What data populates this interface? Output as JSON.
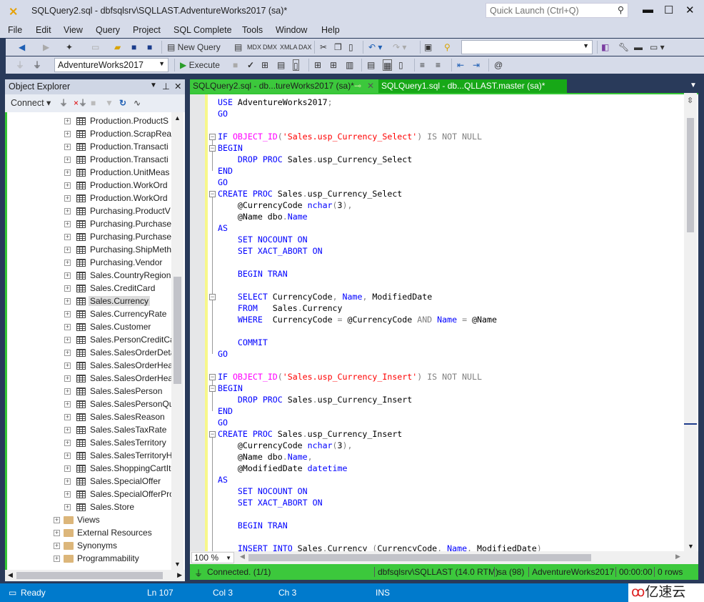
{
  "window": {
    "title": "SQLQuery2.sql - dbfsqlsrv\\SQLLAST.AdventureWorks2017 (sa)*",
    "quick_launch_placeholder": "Quick Launch (Ctrl+Q)"
  },
  "menu": [
    "File",
    "Edit",
    "View",
    "Query",
    "Project",
    "SQL Complete",
    "Tools",
    "Window",
    "Help"
  ],
  "toolbar": {
    "new_query": "New Query",
    "execute": "Execute",
    "database": "AdventureWorks2017",
    "solution_combo": ""
  },
  "object_explorer": {
    "title": "Object Explorer",
    "connect": "Connect",
    "tables": [
      "Production.ProductS",
      "Production.ScrapRea",
      "Production.Transacti",
      "Production.Transacti",
      "Production.UnitMeas",
      "Production.WorkOrd",
      "Production.WorkOrd",
      "Purchasing.ProductV",
      "Purchasing.Purchase",
      "Purchasing.Purchase",
      "Purchasing.ShipMeth",
      "Purchasing.Vendor",
      "Sales.CountryRegion",
      "Sales.CreditCard",
      "Sales.Currency",
      "Sales.CurrencyRate",
      "Sales.Customer",
      "Sales.PersonCreditCa",
      "Sales.SalesOrderDetai",
      "Sales.SalesOrderHeac",
      "Sales.SalesOrderHeac",
      "Sales.SalesPerson",
      "Sales.SalesPersonQuo",
      "Sales.SalesReason",
      "Sales.SalesTaxRate",
      "Sales.SalesTerritory",
      "Sales.SalesTerritoryHi",
      "Sales.ShoppingCartIte",
      "Sales.SpecialOffer",
      "Sales.SpecialOfferPro",
      "Sales.Store"
    ],
    "selected": "Sales.Currency",
    "folders": [
      "Views",
      "External Resources",
      "Synonyms",
      "Programmability"
    ]
  },
  "tabs": [
    {
      "label": "SQLQuery2.sql - db...tureWorks2017 (sa)*",
      "active": true
    },
    {
      "label": "SQLQuery1.sql - db...QLLAST.master (sa)*",
      "active": false
    }
  ],
  "colors": {
    "keyword": "#0000ff",
    "function": "#ff00ff",
    "string": "#ff0000",
    "operator": "#808080",
    "status_green": "#3cc83c",
    "statusbar_blue": "#007acc"
  },
  "code": [
    [
      [
        "k",
        "USE"
      ],
      [
        "t",
        " AdventureWorks2017"
      ],
      [
        "g",
        ";"
      ]
    ],
    [
      [
        "k",
        "GO"
      ]
    ],
    [],
    [
      [
        "k",
        "IF "
      ],
      [
        "f",
        "OBJECT_ID"
      ],
      [
        "g",
        "("
      ],
      [
        "s",
        "'Sales.usp_Currency_Select'"
      ],
      [
        "g",
        ") IS NOT NULL"
      ]
    ],
    [
      [
        "k",
        "BEGIN"
      ]
    ],
    [
      [
        "t",
        "    "
      ],
      [
        "k",
        "DROP PROC"
      ],
      [
        "t",
        " Sales"
      ],
      [
        "g",
        "."
      ],
      [
        "t",
        "usp_Currency_Select"
      ]
    ],
    [
      [
        "k",
        "END"
      ]
    ],
    [
      [
        "k",
        "GO"
      ]
    ],
    [
      [
        "k",
        "CREATE PROC"
      ],
      [
        "t",
        " Sales"
      ],
      [
        "g",
        "."
      ],
      [
        "t",
        "usp_Currency_Select"
      ]
    ],
    [
      [
        "t",
        "    @CurrencyCode "
      ],
      [
        "k",
        "nchar"
      ],
      [
        "g",
        "("
      ],
      [
        "t",
        "3"
      ],
      [
        "g",
        "),"
      ]
    ],
    [
      [
        "t",
        "    @Name dbo"
      ],
      [
        "g",
        "."
      ],
      [
        "k",
        "Name"
      ]
    ],
    [
      [
        "k",
        "AS"
      ]
    ],
    [
      [
        "t",
        "    "
      ],
      [
        "k",
        "SET NOCOUNT ON"
      ]
    ],
    [
      [
        "t",
        "    "
      ],
      [
        "k",
        "SET XACT_ABORT ON"
      ]
    ],
    [],
    [
      [
        "t",
        "    "
      ],
      [
        "k",
        "BEGIN TRAN"
      ]
    ],
    [],
    [
      [
        "t",
        "    "
      ],
      [
        "k",
        "SELECT"
      ],
      [
        "t",
        " CurrencyCode"
      ],
      [
        "g",
        ","
      ],
      [
        "t",
        " "
      ],
      [
        "k",
        "Name"
      ],
      [
        "g",
        ","
      ],
      [
        "t",
        " ModifiedDate"
      ]
    ],
    [
      [
        "t",
        "    "
      ],
      [
        "k",
        "FROM"
      ],
      [
        "t",
        "   Sales"
      ],
      [
        "g",
        "."
      ],
      [
        "t",
        "Currency"
      ]
    ],
    [
      [
        "t",
        "    "
      ],
      [
        "k",
        "WHERE"
      ],
      [
        "t",
        "  CurrencyCode "
      ],
      [
        "g",
        "="
      ],
      [
        "t",
        " @CurrencyCode "
      ],
      [
        "g",
        "AND"
      ],
      [
        "t",
        " "
      ],
      [
        "k",
        "Name"
      ],
      [
        "t",
        " "
      ],
      [
        "g",
        "="
      ],
      [
        "t",
        " @Name"
      ]
    ],
    [],
    [
      [
        "t",
        "    "
      ],
      [
        "k",
        "COMMIT"
      ]
    ],
    [
      [
        "k",
        "GO"
      ]
    ],
    [],
    [
      [
        "k",
        "IF "
      ],
      [
        "f",
        "OBJECT_ID"
      ],
      [
        "g",
        "("
      ],
      [
        "s",
        "'Sales.usp_Currency_Insert'"
      ],
      [
        "g",
        ") IS NOT NULL"
      ]
    ],
    [
      [
        "k",
        "BEGIN"
      ]
    ],
    [
      [
        "t",
        "    "
      ],
      [
        "k",
        "DROP PROC"
      ],
      [
        "t",
        " Sales"
      ],
      [
        "g",
        "."
      ],
      [
        "t",
        "usp_Currency_Insert"
      ]
    ],
    [
      [
        "k",
        "END"
      ]
    ],
    [
      [
        "k",
        "GO"
      ]
    ],
    [
      [
        "k",
        "CREATE PROC"
      ],
      [
        "t",
        " Sales"
      ],
      [
        "g",
        "."
      ],
      [
        "t",
        "usp_Currency_Insert"
      ]
    ],
    [
      [
        "t",
        "    @CurrencyCode "
      ],
      [
        "k",
        "nchar"
      ],
      [
        "g",
        "("
      ],
      [
        "t",
        "3"
      ],
      [
        "g",
        "),"
      ]
    ],
    [
      [
        "t",
        "    @Name dbo"
      ],
      [
        "g",
        "."
      ],
      [
        "k",
        "Name"
      ],
      [
        "g",
        ","
      ]
    ],
    [
      [
        "t",
        "    @ModifiedDate "
      ],
      [
        "k",
        "datetime"
      ]
    ],
    [
      [
        "k",
        "AS"
      ]
    ],
    [
      [
        "t",
        "    "
      ],
      [
        "k",
        "SET NOCOUNT ON"
      ]
    ],
    [
      [
        "t",
        "    "
      ],
      [
        "k",
        "SET XACT_ABORT ON"
      ]
    ],
    [],
    [
      [
        "t",
        "    "
      ],
      [
        "k",
        "BEGIN TRAN"
      ]
    ],
    [],
    [
      [
        "t",
        "    "
      ],
      [
        "k",
        "INSERT INTO"
      ],
      [
        "t",
        " Sales"
      ],
      [
        "g",
        "."
      ],
      [
        "t",
        "Currency "
      ],
      [
        "g",
        "("
      ],
      [
        "t",
        "CurrencyCode"
      ],
      [
        "g",
        ","
      ],
      [
        "t",
        " "
      ],
      [
        "k",
        "Name"
      ],
      [
        "g",
        ","
      ],
      [
        "t",
        " ModifiedDate"
      ],
      [
        "g",
        ")"
      ]
    ]
  ],
  "editor": {
    "zoom": "100 %"
  },
  "connection_status": {
    "text": "Connected. (1/1)",
    "server": "dbfsqlsrv\\SQLLAST (14.0 RTM)",
    "user": "sa (98)",
    "database": "AdventureWorks2017",
    "time": "00:00:00",
    "rows": "0 rows"
  },
  "statusbar": {
    "state": "Ready",
    "line": "Ln 107",
    "col": "Col 3",
    "ch": "Ch 3",
    "mode": "INS"
  },
  "watermark": "亿速云"
}
